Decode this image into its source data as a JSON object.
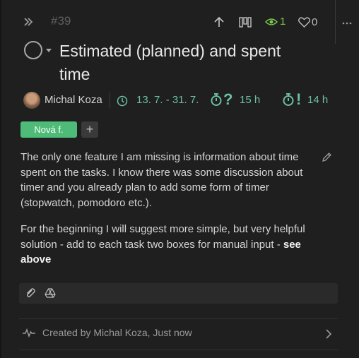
{
  "header": {
    "task_number": "#39",
    "watchers_count": "1",
    "likes_count": "0",
    "icons": [
      "chevron-double-right-icon",
      "arrow-up-icon",
      "board-icon",
      "eye-icon",
      "heart-icon",
      "more-icon"
    ]
  },
  "task": {
    "title": "Estimated (planned) and spent time",
    "author": "Michal Koza",
    "dates": "13. 7. - 31. 7.",
    "estimated_mark": "?",
    "estimated": "15 h",
    "spent_mark": "!",
    "spent": "14 h"
  },
  "tags": {
    "items": [
      {
        "label": "Nová f.",
        "color": "#4ebc78"
      }
    ],
    "add_label": "+"
  },
  "description": {
    "p1": "The only one feature I am missing is information about time spent on the tasks. I know there was some discussion about timer and you already plan to add some form of timer (stopwatch, pomodoro etc.).",
    "p2_text": "For the beginning I will suggest more simple, but very helpful solution - add to each task two boxes for manual input - ",
    "p2_bold": "see above"
  },
  "activity": {
    "text": "Created by Michal Koza, Just now"
  },
  "colors": {
    "background": "#1f1f1f",
    "accent_teal": "#6dbfa1",
    "watch_green": "#7cc84a",
    "tag_green": "#4ebc78"
  }
}
